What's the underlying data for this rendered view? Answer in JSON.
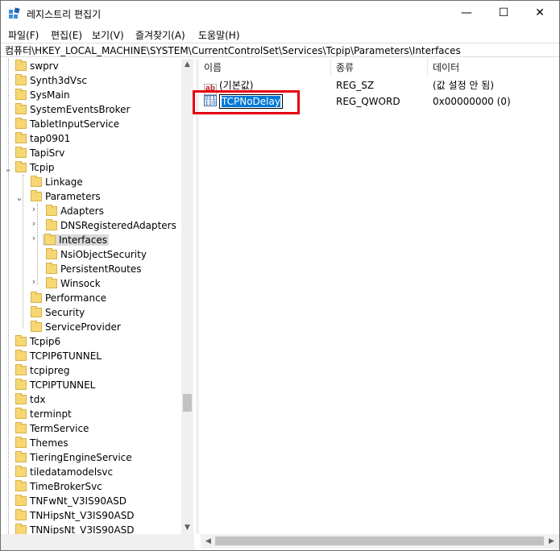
{
  "window": {
    "title": "레지스트리 편집기",
    "controls": {
      "minimize": "—",
      "maximize": "☐",
      "close": "✕"
    }
  },
  "menu": [
    "파일(F)",
    "편집(E)",
    "보기(V)",
    "즐겨찾기(A)",
    "도움말(H)"
  ],
  "address": "컴퓨터\\HKEY_LOCAL_MACHINE\\SYSTEM\\CurrentControlSet\\Services\\Tcpip\\Parameters\\Interfaces",
  "tree": {
    "items": [
      {
        "label": "swprv",
        "level": 0
      },
      {
        "label": "Synth3dVsc",
        "level": 0
      },
      {
        "label": "SysMain",
        "level": 0
      },
      {
        "label": "SystemEventsBroker",
        "level": 0
      },
      {
        "label": "TabletInputService",
        "level": 0
      },
      {
        "label": "tap0901",
        "level": 0
      },
      {
        "label": "TapiSrv",
        "level": 0
      },
      {
        "label": "Tcpip",
        "level": 0
      },
      {
        "label": "Linkage",
        "level": 1
      },
      {
        "label": "Parameters",
        "level": 1
      },
      {
        "label": "Adapters",
        "level": 2
      },
      {
        "label": "DNSRegisteredAdapters",
        "level": 2
      },
      {
        "label": "Interfaces",
        "level": 2
      },
      {
        "label": "NsiObjectSecurity",
        "level": 2
      },
      {
        "label": "PersistentRoutes",
        "level": 2
      },
      {
        "label": "Winsock",
        "level": 2
      },
      {
        "label": "Performance",
        "level": 1
      },
      {
        "label": "Security",
        "level": 1
      },
      {
        "label": "ServiceProvider",
        "level": 1
      },
      {
        "label": "Tcpip6",
        "level": 0
      },
      {
        "label": "TCPIP6TUNNEL",
        "level": 0
      },
      {
        "label": "tcpipreg",
        "level": 0
      },
      {
        "label": "TCPIPTUNNEL",
        "level": 0
      },
      {
        "label": "tdx",
        "level": 0
      },
      {
        "label": "terminpt",
        "level": 0
      },
      {
        "label": "TermService",
        "level": 0
      },
      {
        "label": "Themes",
        "level": 0
      },
      {
        "label": "TieringEngineService",
        "level": 0
      },
      {
        "label": "tiledatamodelsvc",
        "level": 0
      },
      {
        "label": "TimeBrokerSvc",
        "level": 0
      },
      {
        "label": "TNFwNt_V3IS90ASD",
        "level": 0
      },
      {
        "label": "TNHipsNt_V3IS90ASD",
        "level": 0
      },
      {
        "label": "TNNipsNt_V3IS90ASD",
        "level": 0
      }
    ],
    "selected": "Interfaces"
  },
  "values": {
    "headers": [
      "이름",
      "종류",
      "데이터"
    ],
    "rows": [
      {
        "icon": "ab",
        "name": "(기본값)",
        "type": "REG_SZ",
        "data": "(값 설정 안 됨)"
      },
      {
        "icon": "bin",
        "name": "TCPNoDelay",
        "type": "REG_QWORD",
        "data": "0x00000000 (0)"
      }
    ]
  },
  "colors": {
    "highlight_box": "#e60012",
    "selection": "#0078d7"
  },
  "icons": {
    "string_value": "ab-icon",
    "binary_value": "binary-value-icon"
  }
}
